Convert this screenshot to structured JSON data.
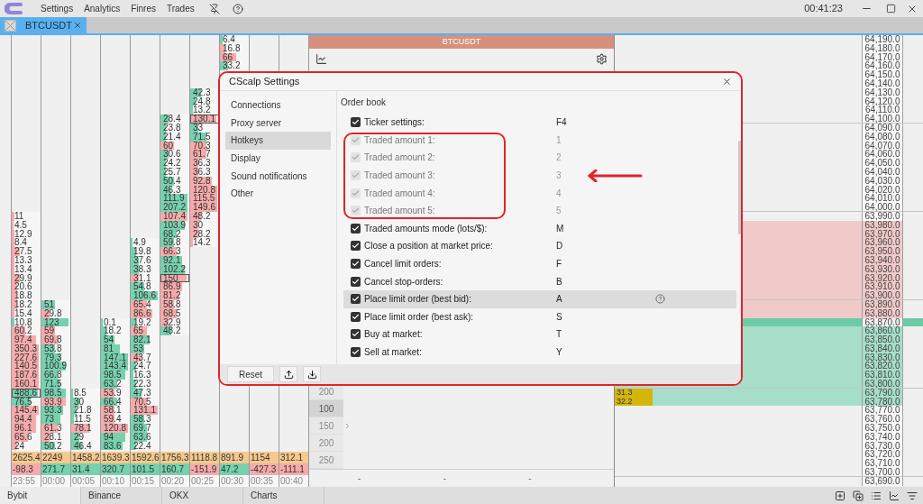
{
  "menu": {
    "items": [
      "Settings",
      "Analytics",
      "Finres",
      "Trades"
    ],
    "clock": "00:41:23"
  },
  "tabs": [
    {
      "label": "BTCUSDT",
      "selected": true
    }
  ],
  "cluster": {
    "columns": [
      {
        "time": "23:55",
        "total": "2625.4",
        "delta": {
          "value": "-98.3",
          "kind": "sell"
        },
        "cells": [
          null,
          null,
          null,
          null,
          null,
          null,
          null,
          null,
          null,
          null,
          null,
          null,
          null,
          null,
          null,
          null,
          null,
          null,
          null,
          null,
          {
            "value": "11",
            "kind": "sell",
            "level": 0.1
          },
          {
            "value": "4.5",
            "kind": "sell",
            "level": 0.05
          },
          {
            "value": "12.9",
            "kind": "sell",
            "level": 0.1
          },
          {
            "value": "8.4",
            "kind": "sell",
            "level": 0.1
          },
          {
            "value": "27.5",
            "kind": "sell",
            "level": 0.3
          },
          {
            "value": "13.3",
            "kind": "sell",
            "level": 0.1
          },
          {
            "value": "13.4",
            "kind": "sell",
            "level": 0.1
          },
          {
            "value": "29.9",
            "kind": "sell",
            "level": 0.3
          },
          {
            "value": "20.6",
            "kind": "sell",
            "level": 0.2
          },
          {
            "value": "18.8",
            "kind": "sell",
            "level": 0.2
          },
          {
            "value": "18.2",
            "kind": "sell",
            "level": 0.2
          },
          {
            "value": "15.4",
            "kind": "sell",
            "level": 0.1
          },
          {
            "value": "10.8",
            "kind": "buy",
            "level": 0.1
          },
          {
            "value": "60.2",
            "kind": "sell",
            "level": 0.5
          },
          {
            "value": "97.4",
            "kind": "sell",
            "level": 0.9
          },
          {
            "value": "350.3",
            "kind": "sell",
            "level": 1
          },
          {
            "value": "227.6",
            "kind": "sell",
            "level": 1
          },
          {
            "value": "140.5",
            "kind": "sell",
            "level": 1
          },
          {
            "value": "187.6",
            "kind": "sell",
            "level": 1
          },
          {
            "value": "160.1",
            "kind": "sell",
            "level": 1
          },
          {
            "value": "488.6",
            "kind": "buy",
            "level": 1,
            "outlined": true
          },
          {
            "value": "76.5",
            "kind": "buy",
            "level": 0.7
          },
          {
            "value": "145.4",
            "kind": "sell",
            "level": 1
          },
          {
            "value": "94.4",
            "kind": "sell",
            "level": 0.9
          },
          {
            "value": "96.1",
            "kind": "sell",
            "level": 0.9
          },
          {
            "value": "65.6",
            "kind": "sell",
            "level": 0.6
          },
          {
            "value": "24",
            "kind": "sell",
            "level": 0.2
          }
        ]
      },
      {
        "time": "00:00",
        "total": "2249",
        "delta": {
          "value": "271.7",
          "kind": "buy"
        },
        "cells": [
          null,
          null,
          null,
          null,
          null,
          null,
          null,
          null,
          null,
          null,
          null,
          null,
          null,
          null,
          null,
          null,
          null,
          null,
          null,
          null,
          null,
          null,
          null,
          null,
          null,
          null,
          null,
          null,
          null,
          null,
          {
            "value": "51",
            "kind": "buy",
            "level": 0.5
          },
          {
            "value": "29.8",
            "kind": "sell",
            "level": 0.3
          },
          {
            "value": "123",
            "kind": "buy",
            "level": 1
          },
          {
            "value": "59",
            "kind": "sell",
            "level": 0.5
          },
          {
            "value": "69.8",
            "kind": "sell",
            "level": 0.6
          },
          {
            "value": "53.8",
            "kind": "buy",
            "level": 0.5
          },
          {
            "value": "79.3",
            "kind": "buy",
            "level": 0.7
          },
          {
            "value": "100.9",
            "kind": "buy",
            "level": 0.9
          },
          {
            "value": "66.8",
            "kind": "buy",
            "level": 0.6
          },
          {
            "value": "71.5",
            "kind": "buy",
            "level": 0.7
          },
          {
            "value": "98.5",
            "kind": "buy",
            "level": 0.9
          },
          {
            "value": "93.9",
            "kind": "sell",
            "level": 0.9
          },
          {
            "value": "93.3",
            "kind": "buy",
            "level": 0.8
          },
          {
            "value": "73",
            "kind": "buy",
            "level": 0.7
          },
          {
            "value": "61.3",
            "kind": "sell",
            "level": 0.6
          },
          {
            "value": "28.1",
            "kind": "sell",
            "level": 0.3
          },
          {
            "value": "50.2",
            "kind": "buy",
            "level": 0.5
          }
        ]
      },
      {
        "time": "00:05",
        "total": "1458.2",
        "delta": {
          "value": "31.4",
          "kind": "buy"
        },
        "cells": [
          null,
          null,
          null,
          null,
          null,
          null,
          null,
          null,
          null,
          null,
          null,
          null,
          null,
          null,
          null,
          null,
          null,
          null,
          null,
          null,
          null,
          null,
          null,
          null,
          null,
          null,
          null,
          null,
          null,
          null,
          null,
          null,
          null,
          null,
          null,
          null,
          null,
          null,
          null,
          null,
          {
            "value": "8.5",
            "kind": "buy",
            "level": 0.05
          },
          {
            "value": "30",
            "kind": "buy",
            "level": 0.3
          },
          {
            "value": "21.8",
            "kind": "buy",
            "level": 0.2
          },
          {
            "value": "11.5",
            "kind": "buy",
            "level": 0.1
          },
          {
            "value": "78.1",
            "kind": "sell",
            "level": 0.7
          },
          {
            "value": "29",
            "kind": "buy",
            "level": 0.3
          },
          {
            "value": "46.4",
            "kind": "buy",
            "level": 0.4
          }
        ]
      },
      {
        "time": "00:10",
        "total": "1639.3",
        "delta": {
          "value": "320.7",
          "kind": "buy"
        },
        "cells": [
          null,
          null,
          null,
          null,
          null,
          null,
          null,
          null,
          null,
          null,
          null,
          null,
          null,
          null,
          null,
          null,
          null,
          null,
          null,
          null,
          null,
          null,
          null,
          null,
          null,
          null,
          null,
          null,
          null,
          null,
          null,
          null,
          {
            "value": "0.1",
            "kind": "buy",
            "level": 0.05
          },
          {
            "value": "18.2",
            "kind": "buy",
            "level": 0.2
          },
          {
            "value": "54",
            "kind": "buy",
            "level": 0.5
          },
          {
            "value": "81",
            "kind": "buy",
            "level": 0.7
          },
          {
            "value": "147.1",
            "kind": "buy",
            "level": 1
          },
          {
            "value": "143.4",
            "kind": "buy",
            "level": 1
          },
          {
            "value": "98.5",
            "kind": "buy",
            "level": 0.9
          },
          {
            "value": "63.2",
            "kind": "buy",
            "level": 0.6
          },
          {
            "value": "53.9",
            "kind": "sell",
            "level": 0.5
          },
          {
            "value": "66.4",
            "kind": "buy",
            "level": 0.6
          },
          {
            "value": "58.1",
            "kind": "sell",
            "level": 0.5
          },
          {
            "value": "59.4",
            "kind": "sell",
            "level": 0.5
          },
          {
            "value": "120.8",
            "kind": "sell",
            "level": 1
          },
          {
            "value": "94",
            "kind": "buy",
            "level": 0.9
          },
          {
            "value": "83.6",
            "kind": "buy",
            "level": 0.8
          }
        ]
      },
      {
        "time": "00:15",
        "total": "1592.6",
        "delta": {
          "value": "101.5",
          "kind": "buy"
        },
        "cells": [
          null,
          null,
          null,
          null,
          null,
          null,
          null,
          null,
          null,
          null,
          null,
          null,
          null,
          null,
          null,
          null,
          null,
          null,
          null,
          null,
          null,
          null,
          null,
          {
            "value": "4.9",
            "kind": "buy",
            "level": 0.05
          },
          {
            "value": "19.8",
            "kind": "buy",
            "level": 0.2
          },
          {
            "value": "37.6",
            "kind": "buy",
            "level": 0.3
          },
          {
            "value": "38.3",
            "kind": "buy",
            "level": 0.3
          },
          {
            "value": "31.1",
            "kind": "sell",
            "level": 0.3
          },
          {
            "value": "54.8",
            "kind": "buy",
            "level": 0.5
          },
          {
            "value": "106.6",
            "kind": "buy",
            "level": 1
          },
          {
            "value": "65.4",
            "kind": "sell",
            "level": 0.6
          },
          {
            "value": "86.6",
            "kind": "sell",
            "level": 0.8
          },
          {
            "value": "19.2",
            "kind": "buy",
            "level": 0.2
          },
          {
            "value": "65",
            "kind": "sell",
            "level": 0.6
          },
          {
            "value": "82.1",
            "kind": "buy",
            "level": 0.7
          },
          {
            "value": "53",
            "kind": "buy",
            "level": 0.5
          },
          {
            "value": "43.7",
            "kind": "sell",
            "level": 0.4
          },
          {
            "value": "24.7",
            "kind": "buy",
            "level": 0.2
          },
          {
            "value": "16.3",
            "kind": "buy",
            "level": 0.1
          },
          {
            "value": "22.3",
            "kind": "buy",
            "level": 0.2
          },
          {
            "value": "47.3",
            "kind": "buy",
            "level": 0.4
          },
          {
            "value": "70.5",
            "kind": "sell",
            "level": 0.6
          },
          {
            "value": "131.1",
            "kind": "sell",
            "level": 1
          },
          {
            "value": "58.3",
            "kind": "buy",
            "level": 0.5
          },
          {
            "value": "69.7",
            "kind": "buy",
            "level": 0.6
          },
          {
            "value": "63.6",
            "kind": "buy",
            "level": 0.6
          },
          {
            "value": "22.4",
            "kind": "buy",
            "level": 0.2
          }
        ]
      },
      {
        "time": "00:20",
        "total": "1756.3",
        "delta": {
          "value": "160.7",
          "kind": "buy"
        },
        "cells": [
          null,
          null,
          null,
          null,
          null,
          null,
          null,
          null,
          null,
          {
            "value": "28.4",
            "kind": "buy",
            "level": 0.3
          },
          {
            "value": "23.8",
            "kind": "buy",
            "level": 0.2
          },
          {
            "value": "21.4",
            "kind": "buy",
            "level": 0.2
          },
          {
            "value": "60",
            "kind": "sell",
            "level": 0.5
          },
          {
            "value": "30.6",
            "kind": "buy",
            "level": 0.3
          },
          {
            "value": "24.2",
            "kind": "buy",
            "level": 0.2
          },
          {
            "value": "25.7",
            "kind": "buy",
            "level": 0.2
          },
          {
            "value": "50.4",
            "kind": "buy",
            "level": 0.5
          },
          {
            "value": "46.3",
            "kind": "buy",
            "level": 0.4
          },
          {
            "value": "111.9",
            "kind": "buy",
            "level": 1
          },
          {
            "value": "207.2",
            "kind": "buy",
            "level": 1
          },
          {
            "value": "107.4",
            "kind": "sell",
            "level": 1
          },
          {
            "value": "103.9",
            "kind": "buy",
            "level": 0.9
          },
          {
            "value": "68.2",
            "kind": "buy",
            "level": 0.6
          },
          {
            "value": "59.8",
            "kind": "buy",
            "level": 0.5
          },
          {
            "value": "66.3",
            "kind": "sell",
            "level": 0.6
          },
          {
            "value": "92.1",
            "kind": "buy",
            "level": 0.8
          },
          {
            "value": "102.2",
            "kind": "buy",
            "level": 0.9
          },
          {
            "value": "150",
            "kind": "sell",
            "level": 1,
            "outlined": true
          },
          {
            "value": "86.9",
            "kind": "sell",
            "level": 0.8
          },
          {
            "value": "81.2",
            "kind": "sell",
            "level": 0.7
          },
          {
            "value": "58.8",
            "kind": "sell",
            "level": 0.5
          },
          {
            "value": "68.5",
            "kind": "sell",
            "level": 0.6
          },
          {
            "value": "32.9",
            "kind": "sell",
            "level": 0.3
          },
          {
            "value": "48.2",
            "kind": "buy",
            "level": 0.4
          }
        ]
      },
      {
        "time": "00:25",
        "total": "1118.8",
        "delta": {
          "value": "-151.9",
          "kind": "sell"
        },
        "cells": [
          null,
          null,
          null,
          null,
          null,
          null,
          {
            "value": "42.3",
            "kind": "buy",
            "level": 0.4
          },
          {
            "value": "24.8",
            "kind": "buy",
            "level": 0.2
          },
          {
            "value": "13.2",
            "kind": "buy",
            "level": 0.1
          },
          {
            "value": "130.1",
            "kind": "sell",
            "level": 1,
            "outlined": true
          },
          {
            "value": "33",
            "kind": "buy",
            "level": 0.3
          },
          {
            "value": "71.5",
            "kind": "buy",
            "level": 0.6
          },
          {
            "value": "70.3",
            "kind": "sell",
            "level": 0.6
          },
          {
            "value": "61.7",
            "kind": "sell",
            "level": 0.6
          },
          {
            "value": "36.3",
            "kind": "sell",
            "level": 0.3
          },
          {
            "value": "36.3",
            "kind": "sell",
            "level": 0.3
          },
          {
            "value": "92.8",
            "kind": "sell",
            "level": 0.8
          },
          {
            "value": "120.8",
            "kind": "sell",
            "level": 1
          },
          {
            "value": "115.5",
            "kind": "sell",
            "level": 1
          },
          {
            "value": "149.6",
            "kind": "sell",
            "level": 1
          },
          {
            "value": "48.2",
            "kind": "sell",
            "level": 0.4
          },
          {
            "value": "30",
            "kind": "sell",
            "level": 0.3
          },
          {
            "value": "28.2",
            "kind": "sell",
            "level": 0.3
          },
          {
            "value": "14.2",
            "kind": "sell",
            "level": 0.1
          }
        ]
      },
      {
        "time": "00:30",
        "total": "891.9",
        "delta": {
          "value": "47.2",
          "kind": "buy"
        },
        "cells": [
          {
            "value": "6.4",
            "kind": "buy",
            "level": 0.1
          },
          {
            "value": "16.8",
            "kind": "sell",
            "level": 0.2
          },
          {
            "value": "66",
            "kind": "sell",
            "level": 0.6
          },
          {
            "value": "33.2",
            "kind": "buy",
            "level": 0.3
          }
        ]
      },
      {
        "time": "00:35",
        "total": "1154",
        "delta": {
          "value": "-427.3",
          "kind": "sell"
        }
      },
      {
        "time": "00:40",
        "total": "312.1",
        "delta": {
          "value": "-111.1",
          "kind": "sell"
        }
      }
    ]
  },
  "book": {
    "title": "BTCUSDT",
    "scale": [
      {
        "label": "200",
        "selected": false
      },
      {
        "label": "100",
        "selected": true
      },
      {
        "label": "150",
        "selected": false
      },
      {
        "label": "200",
        "selected": false
      },
      {
        "label": "250",
        "selected": false
      }
    ],
    "footer": [
      "-",
      "-",
      "-"
    ]
  },
  "prices": [
    {
      "price": "64,190.0",
      "kind": "plain"
    },
    {
      "price": "64,180.0",
      "kind": "plain"
    },
    {
      "price": "64,170.0",
      "kind": "plain"
    },
    {
      "price": "64,160.0",
      "kind": "plain"
    },
    {
      "price": "64,150.0",
      "kind": "plain"
    },
    {
      "price": "64,140.0",
      "kind": "plain"
    },
    {
      "price": "64,130.0",
      "kind": "plain"
    },
    {
      "price": "64,120.0",
      "kind": "plain"
    },
    {
      "price": "64,110.0",
      "kind": "plain"
    },
    {
      "price": "64,100.0",
      "kind": "plain"
    },
    {
      "price": "64,090.0",
      "kind": "plain"
    },
    {
      "price": "64,080.0",
      "kind": "plain"
    },
    {
      "price": "64,070.0",
      "kind": "plain"
    },
    {
      "price": "64,060.0",
      "kind": "plain"
    },
    {
      "price": "64,050.0",
      "kind": "plain"
    },
    {
      "price": "64,040.0",
      "kind": "plain"
    },
    {
      "price": "64,030.0",
      "kind": "plain"
    },
    {
      "price": "64,020.0",
      "kind": "plain"
    },
    {
      "price": "64,010.0",
      "kind": "plain"
    },
    {
      "price": "64,000.0",
      "kind": "plain"
    },
    {
      "price": "63,990.0",
      "kind": "plain"
    },
    {
      "price": "63,980.0",
      "kind": "ask"
    },
    {
      "price": "63,970.0",
      "kind": "ask"
    },
    {
      "price": "63,960.0",
      "kind": "ask"
    },
    {
      "price": "63,950.0",
      "kind": "ask"
    },
    {
      "price": "63,940.0",
      "kind": "ask"
    },
    {
      "price": "63,930.0",
      "kind": "ask"
    },
    {
      "price": "63,920.0",
      "kind": "ask"
    },
    {
      "price": "63,910.0",
      "kind": "ask"
    },
    {
      "price": "63,900.0",
      "kind": "ask"
    },
    {
      "price": "63,890.0",
      "kind": "ask"
    },
    {
      "price": "63,880.0",
      "kind": "ask"
    },
    {
      "price": "63,870.0",
      "kind": "best"
    },
    {
      "price": "63,860.0",
      "kind": "bid"
    },
    {
      "price": "63,850.0",
      "kind": "bid"
    },
    {
      "price": "63,840.0",
      "kind": "bid"
    },
    {
      "price": "63,830.0",
      "kind": "bid"
    },
    {
      "price": "63,820.0",
      "kind": "bid"
    },
    {
      "price": "63,810.0",
      "kind": "bid"
    },
    {
      "price": "63,800.0",
      "kind": "bid"
    },
    {
      "price": "63,790.0",
      "kind": "bid",
      "volume": "31.3"
    },
    {
      "price": "63,780.0",
      "kind": "bid",
      "volume": "32.2"
    },
    {
      "price": "63,770.0",
      "kind": "plain"
    },
    {
      "price": "63,760.0",
      "kind": "plain"
    },
    {
      "price": "63,750.0",
      "kind": "plain"
    },
    {
      "price": "63,740.0",
      "kind": "plain"
    },
    {
      "price": "63,730.0",
      "kind": "plain"
    },
    {
      "price": "63,720.0",
      "kind": "plain"
    },
    {
      "price": "63,710.0",
      "kind": "plain"
    },
    {
      "price": "63,700.0",
      "kind": "plain"
    },
    {
      "price": "63,690.0",
      "kind": "plain"
    }
  ],
  "dialog": {
    "title": "CScalp Settings",
    "nav": [
      {
        "label": "Connections",
        "selected": false
      },
      {
        "label": "Proxy server",
        "selected": false
      },
      {
        "label": "Hotkeys",
        "selected": true
      },
      {
        "label": "Display",
        "selected": false
      },
      {
        "label": "Sound notifications",
        "selected": false
      },
      {
        "label": "Other",
        "selected": false
      }
    ],
    "section": "Order book",
    "hotkeys": [
      {
        "label": "Ticker settings:",
        "key": "F4",
        "checked": true,
        "disabled": false,
        "selected": false,
        "annotated": false
      },
      {
        "label": "Traded amount 1:",
        "key": "1",
        "checked": true,
        "disabled": true,
        "selected": false,
        "annotated": true
      },
      {
        "label": "Traded amount 2:",
        "key": "2",
        "checked": true,
        "disabled": true,
        "selected": false,
        "annotated": true
      },
      {
        "label": "Traded amount 3:",
        "key": "3",
        "checked": true,
        "disabled": true,
        "selected": false,
        "annotated": true
      },
      {
        "label": "Traded amount 4:",
        "key": "4",
        "checked": true,
        "disabled": true,
        "selected": false,
        "annotated": true
      },
      {
        "label": "Traded amount 5:",
        "key": "5",
        "checked": true,
        "disabled": true,
        "selected": false,
        "annotated": true
      },
      {
        "label": "Traded amounts mode (lots/$):",
        "key": "M",
        "checked": true,
        "disabled": false,
        "selected": false,
        "annotated": false
      },
      {
        "label": "Close a position at market price:",
        "key": "D",
        "checked": true,
        "disabled": false,
        "selected": false,
        "annotated": false
      },
      {
        "label": "Cancel limit orders:",
        "key": "F",
        "checked": true,
        "disabled": false,
        "selected": false,
        "annotated": false
      },
      {
        "label": "Cancel stop-orders:",
        "key": "B",
        "checked": true,
        "disabled": false,
        "selected": false,
        "annotated": false
      },
      {
        "label": "Place limit order (best bid):",
        "key": "A",
        "checked": true,
        "disabled": false,
        "selected": true,
        "annotated": false
      },
      {
        "label": "Place limit order (best ask):",
        "key": "S",
        "checked": true,
        "disabled": false,
        "selected": false,
        "annotated": false
      },
      {
        "label": "Buy at market:",
        "key": "T",
        "checked": true,
        "disabled": false,
        "selected": false,
        "annotated": false
      },
      {
        "label": "Sell at market:",
        "key": "Y",
        "checked": true,
        "disabled": false,
        "selected": false,
        "annotated": false
      }
    ],
    "reset": "Reset"
  },
  "exchange_tabs": [
    {
      "label": "Bybit",
      "selected": true
    },
    {
      "label": "Binance",
      "selected": false
    },
    {
      "label": "OKX",
      "selected": false
    },
    {
      "label": "Charts",
      "selected": false
    }
  ]
}
